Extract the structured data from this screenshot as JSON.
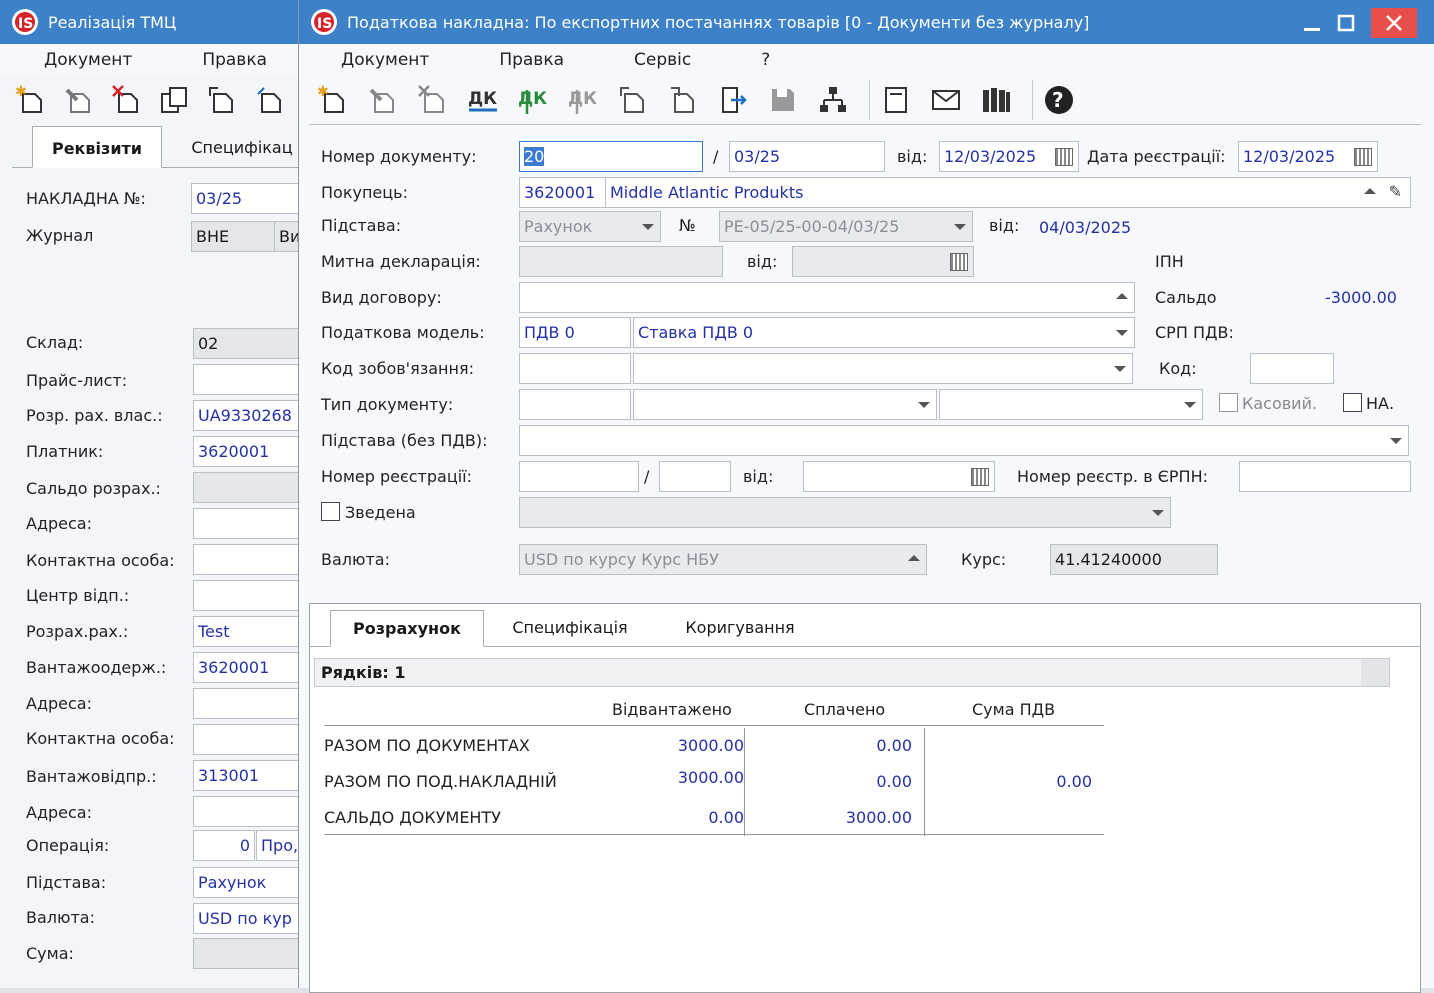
{
  "back_window": {
    "title": "Реалізація ТМЦ",
    "menu": [
      "Документ",
      "Правка"
    ],
    "tabs": [
      "Реквізити",
      "Специфікац"
    ],
    "labels": {
      "nakladna": "НАКЛАДНА №:",
      "zhurnal": "Журнал",
      "sklad": "Склад:",
      "price": "Прайс-лист:",
      "rozr_vlas": "Розр. рах. влас.:",
      "platnyk": "Платник:",
      "saldo": "Сальдо розрах.:",
      "adresa1": "Адреса:",
      "kontakt1": "Контактна особа:",
      "centr": "Центр відп.:",
      "rozr_rah": "Розрах.рах.:",
      "vantazhoderzh": "Вантажоодерж.:",
      "adresa2": "Адреса:",
      "kontakt2": "Контактна особа:",
      "vantazhovidpr": "Вантажовідпр.:",
      "adresa3": "Адреса:",
      "operacia": "Операція:",
      "pidstava": "Підстава:",
      "valuta": "Валюта:",
      "suma": "Сума:"
    },
    "values": {
      "nakladna": "03/25",
      "zhurnal": "ВНЕ",
      "zhurnal2": "Ви",
      "sklad": "02",
      "rozr_vlas": "UA9330268",
      "platnyk": "3620001",
      "rozr_rah": "Test",
      "vantazhoderzh": "3620001",
      "vantazhovidpr": "313001",
      "operacia_num": "0",
      "operacia_name": "Про,",
      "pidstava": "Рахунок",
      "valuta": "USD по кур"
    }
  },
  "front_window": {
    "title": "Податкова накладна: По експортних  постачаннях товарів [0 - Документи без журналу]",
    "menu": [
      "Документ",
      "Правка",
      "Сервіс",
      "?"
    ],
    "labels": {
      "nomer_doc": "Номер документу:",
      "slash": "/",
      "vid": "від:",
      "data_reestr": "Дата реєстрації:",
      "pokupets": "Покупець:",
      "pidstava": "Підстава:",
      "no": "№",
      "vid2": "від:",
      "mytna": "Митна декларація:",
      "vid3": "від:",
      "ipn": "ІПН",
      "vyd_dogovoru": "Вид договору:",
      "saldo": "Сальдо",
      "podatkova_model": "Податкова модель:",
      "srp": "СРП ПДВ:",
      "kod_zobov": "Код зобов'язання:",
      "kod": "Код:",
      "typ_doc": "Тип документу:",
      "kasovyi": "Касовий.",
      "na": "НА.",
      "pidstava_bez": "Підстава (без ПДВ):",
      "nomer_reestr": "Номер реєстрації:",
      "vid4": "від:",
      "nomer_erpn": "Номер реєстр. в ЄРПН:",
      "zvedena": "Зведена",
      "valuta": "Валюта:",
      "kurs": "Курс:"
    },
    "values": {
      "nomer_doc": "20",
      "nomer_doc2": "03/25",
      "date": "12/03/2025",
      "date_reestr": "12/03/2025",
      "pokupets_code": "3620001",
      "pokupets_name": "Middle Atlantic Produkts",
      "pidstava": "Рахунок",
      "pidstava_no": "РЕ-05/25-00-04/03/25",
      "pidstava_date": "04/03/2025",
      "saldo": "-3000.00",
      "model_code": "ПДВ  0",
      "model_name": "Ставка ПДВ 0",
      "valuta": "USD по курсу Курс НБУ",
      "kurs": "41.41240000"
    },
    "tabs": [
      "Розрахунок",
      "Специфікація",
      "Коригування"
    ],
    "rows_label": "Рядків: 1",
    "summary": {
      "headers": [
        "Відвантажено",
        "Сплачено",
        "Сума ПДВ"
      ],
      "rows": [
        {
          "label": "РАЗОМ ПО ДОКУМЕНТАХ",
          "shipped": "3000.00",
          "paid": "0.00",
          "vat": ""
        },
        {
          "label": "РАЗОМ ПО ПОД.НАКЛАДНІЙ",
          "shipped": "3000.00",
          "paid": "0.00",
          "vat": "0.00"
        },
        {
          "label": "САЛЬДО ДОКУМЕНТУ",
          "shipped": "0.00",
          "paid": "3000.00",
          "vat": ""
        }
      ]
    }
  },
  "colors": {
    "titlebar": "#3d82c8",
    "value_text": "#2431a6",
    "close_btn": "#e7504a"
  }
}
